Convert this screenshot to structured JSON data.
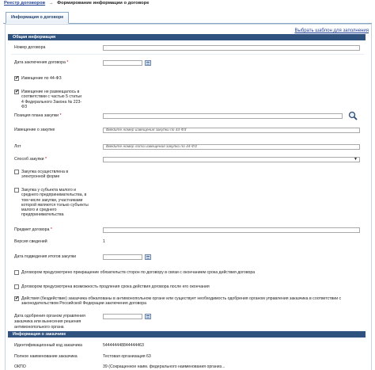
{
  "breadcrumb": {
    "registry_link": "Реестр договоров",
    "arrow": "→",
    "current": "Формирование информации о договоре"
  },
  "tab": {
    "label": "Информация о договоре"
  },
  "template_link": "Выбрать шаблон для заполнения",
  "general_section": {
    "header": "Общая информация",
    "contract_number_label": "Номер договора",
    "contract_date_label": "Дата заключения договора",
    "notice_44fz_label": "Извещение по 44-ФЗ",
    "notice_not_posted_label": "Извещение не размещалось в соответствии с частью 5 статьи 4 Федерального Закона № 223-ФЗ",
    "plan_position_label": "Позиция плана закупки",
    "notice_label": "Извещение о закупке",
    "notice_placeholder": "Введите номер извещения закупки по 44-ФЗ",
    "lot_label": "Лот",
    "lot_placeholder": "Введите номер лота извещения закупки по 44-ФЗ",
    "method_label": "Способ закупки",
    "electronic_label": "Закупка осуществлена в электронной форме",
    "sme_label": "Закупка у субъекта малого и среднего предпринимательства, в том числе закупки, участниками которой являются только субъекты малого и среднего предпринимательства",
    "subject_label": "Предмет договора",
    "version_label": "Версия сведений",
    "version_value": "1",
    "summary_date_label": "Дата подведения итогов закупки",
    "termination_label": "Договором предусмотрено прекращение обязательств сторон по договору в связи с окончанием срока действия договора",
    "extension_label": "Договором предусмотрена возможность продления срока действия договора после его окончания",
    "antimonopoly_label": "Действия (бездействие) заказчика обжалованы в антимонопольном органе или существует необходимость одобрения органом управления заказчика в соответствии с законодательством Российской Федерации заключения договора",
    "approval_date_label": "Дата одобрения органом управления заказчика или вынесения решения антимонопольного органа",
    "required_mark": "*"
  },
  "customer_section": {
    "header": "Информация о заказчике",
    "id_code_label": "Идентификационный код заказчика",
    "id_code_value": "544444448844444463",
    "full_name_label": "Полное наименование заказчика",
    "full_name_value": "Тестовая организация 63",
    "okpo_label": "ОКПО",
    "okpo_value": "39 (Сокращенное наим. федерального наименования организ..."
  },
  "checkboxes": {
    "notice_44fz": true,
    "notice_not_posted": true,
    "electronic": false,
    "sme": false,
    "termination": false,
    "extension": false,
    "antimonopoly": true
  },
  "colors": {
    "section_header_bg": "#2f527e",
    "link": "#1f3f95",
    "required": "#cc0000"
  }
}
